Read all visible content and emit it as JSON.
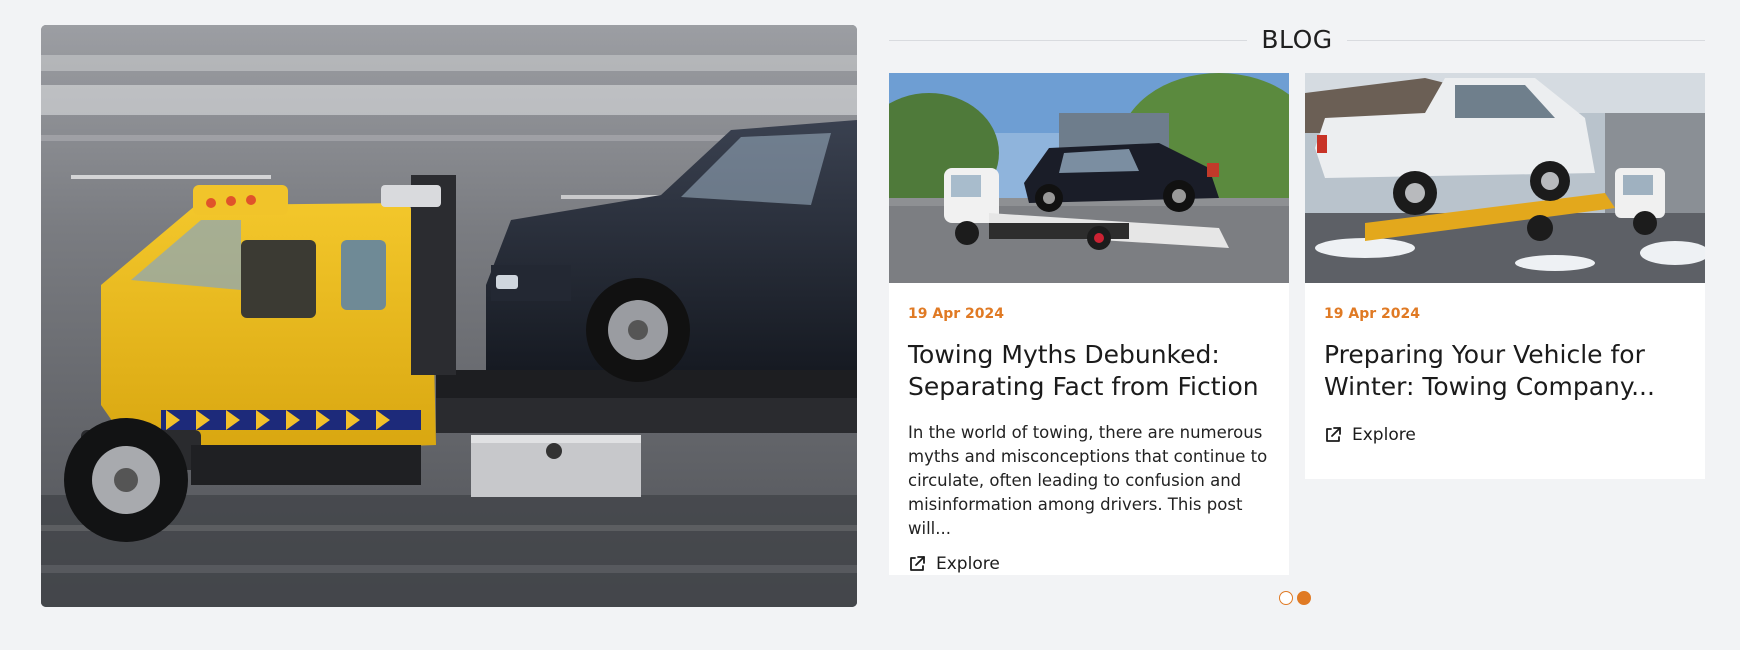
{
  "hero": {
    "image": "tow-truck-carrying-suv-photo"
  },
  "blog": {
    "heading": "BLOG",
    "cards": [
      {
        "image": "flatbed-tow-truck-with-black-suv-photo",
        "date": "19 Apr 2024",
        "title": "Towing Myths Debunked: Separating Fact from Fiction",
        "excerpt": "In the world of towing, there are numerous myths and misconceptions that continue to circulate, often leading to confusion and misinformation among drivers. This post will...",
        "explore_label": "Explore",
        "explore_icon": "external-link-icon"
      },
      {
        "image": "tow-truck-with-white-pickup-photo",
        "date": "19 Apr 2024",
        "title": "Preparing Your Vehicle for Winter: Towing Company...",
        "excerpt": "",
        "explore_label": "Explore",
        "explore_icon": "external-link-icon"
      }
    ]
  },
  "pagination": {
    "count": 2,
    "active_index": 1
  },
  "colors": {
    "accent": "#e07a24",
    "page_background": "#f2f3f5",
    "card_background": "#ffffff"
  }
}
